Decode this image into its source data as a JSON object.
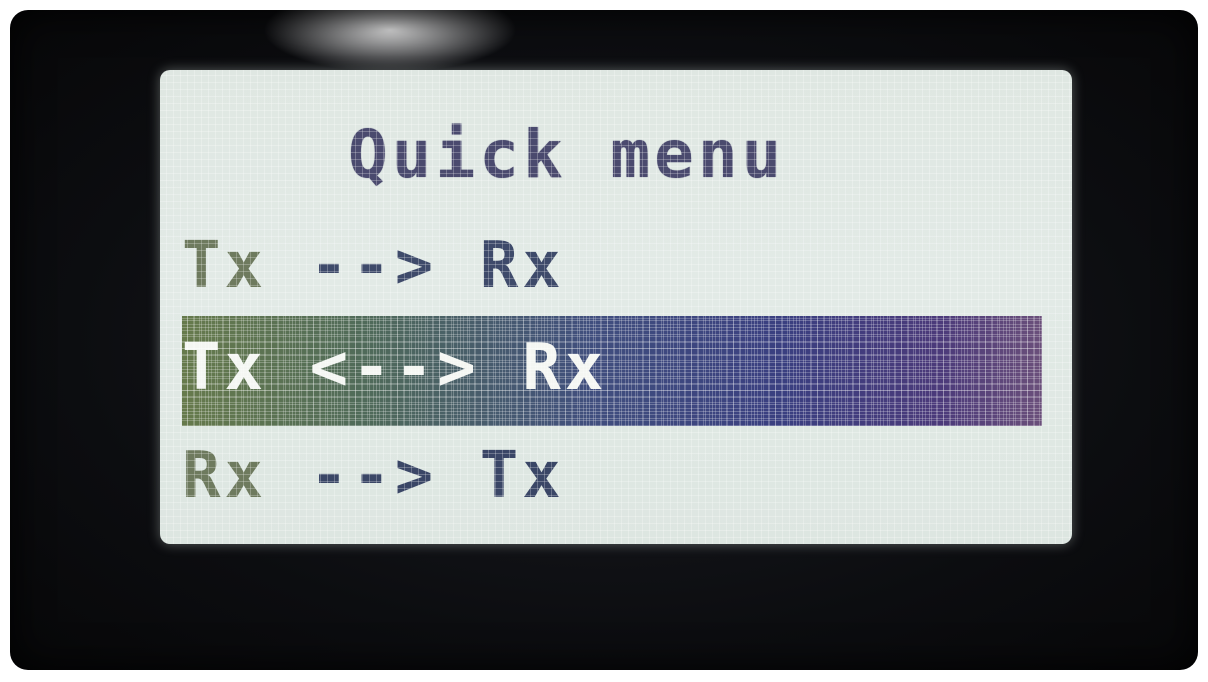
{
  "menu": {
    "title": "Quick menu",
    "items": [
      {
        "left": "Tx",
        "arrow": " --> ",
        "right": "Rx",
        "selected": false
      },
      {
        "left": "Tx",
        "arrow": " <--> ",
        "right": "Rx",
        "selected": true
      },
      {
        "left": "Rx",
        "arrow": " --> ",
        "right": "Tx",
        "selected": false
      }
    ]
  },
  "colors": {
    "screen_background": "#dfe7e2",
    "text": "#3e4a6a",
    "selection_highlight_start": "#667a4c",
    "selection_highlight_end": "#3a3f80",
    "bezel": "#0c0d10"
  }
}
